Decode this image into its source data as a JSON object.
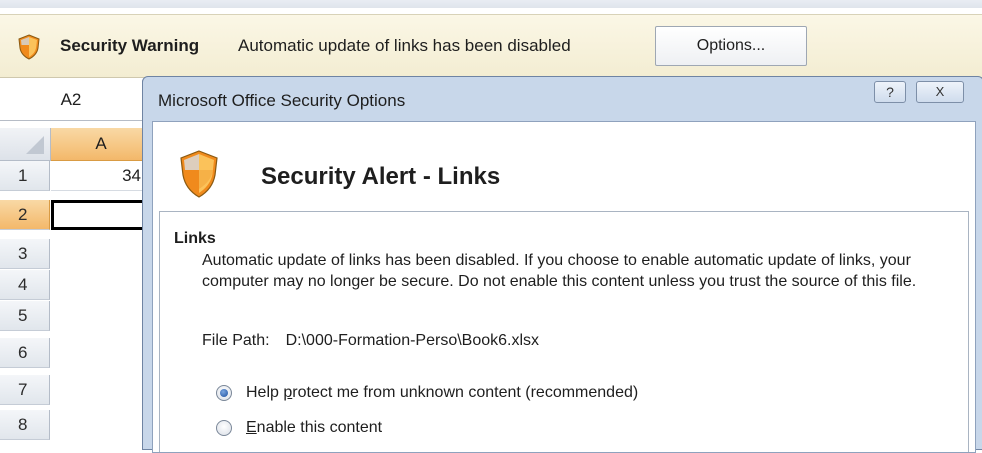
{
  "warning_bar": {
    "title": "Security Warning",
    "message": "Automatic update of links has been disabled",
    "options_label": "Options..."
  },
  "sheet": {
    "name_box": "A2",
    "column_header": "A",
    "rows": [
      {
        "num": "1",
        "value": "34"
      },
      {
        "num": "2",
        "value": ""
      },
      {
        "num": "3",
        "value": ""
      },
      {
        "num": "4",
        "value": ""
      },
      {
        "num": "5",
        "value": ""
      },
      {
        "num": "6",
        "value": ""
      },
      {
        "num": "7",
        "value": ""
      },
      {
        "num": "8",
        "value": ""
      }
    ]
  },
  "dialog": {
    "title": "Microsoft Office Security Options",
    "help_glyph": "?",
    "close_glyph": "X",
    "alert_title": "Security Alert - Links",
    "section_heading": "Links",
    "description": "Automatic update of links has been disabled. If you choose to enable automatic update of links, your computer may no longer be secure. Do not enable this content unless you trust the source of this file.",
    "file_path_label": "File Path:",
    "file_path_value": "D:\\000-Formation-Perso\\Book6.xlsx",
    "options": [
      {
        "prefix": "Help ",
        "mnemonic": "p",
        "suffix": "rotect me from unknown content (recommended)",
        "selected": true
      },
      {
        "prefix": "",
        "mnemonic": "E",
        "suffix": "nable this content",
        "selected": false
      }
    ]
  },
  "colors": {
    "warning_bg": "#f3edd2",
    "dialog_frame": "#c8d7ea",
    "selected_header": "#f3b86a",
    "shield_orange": "#f08a1c"
  }
}
